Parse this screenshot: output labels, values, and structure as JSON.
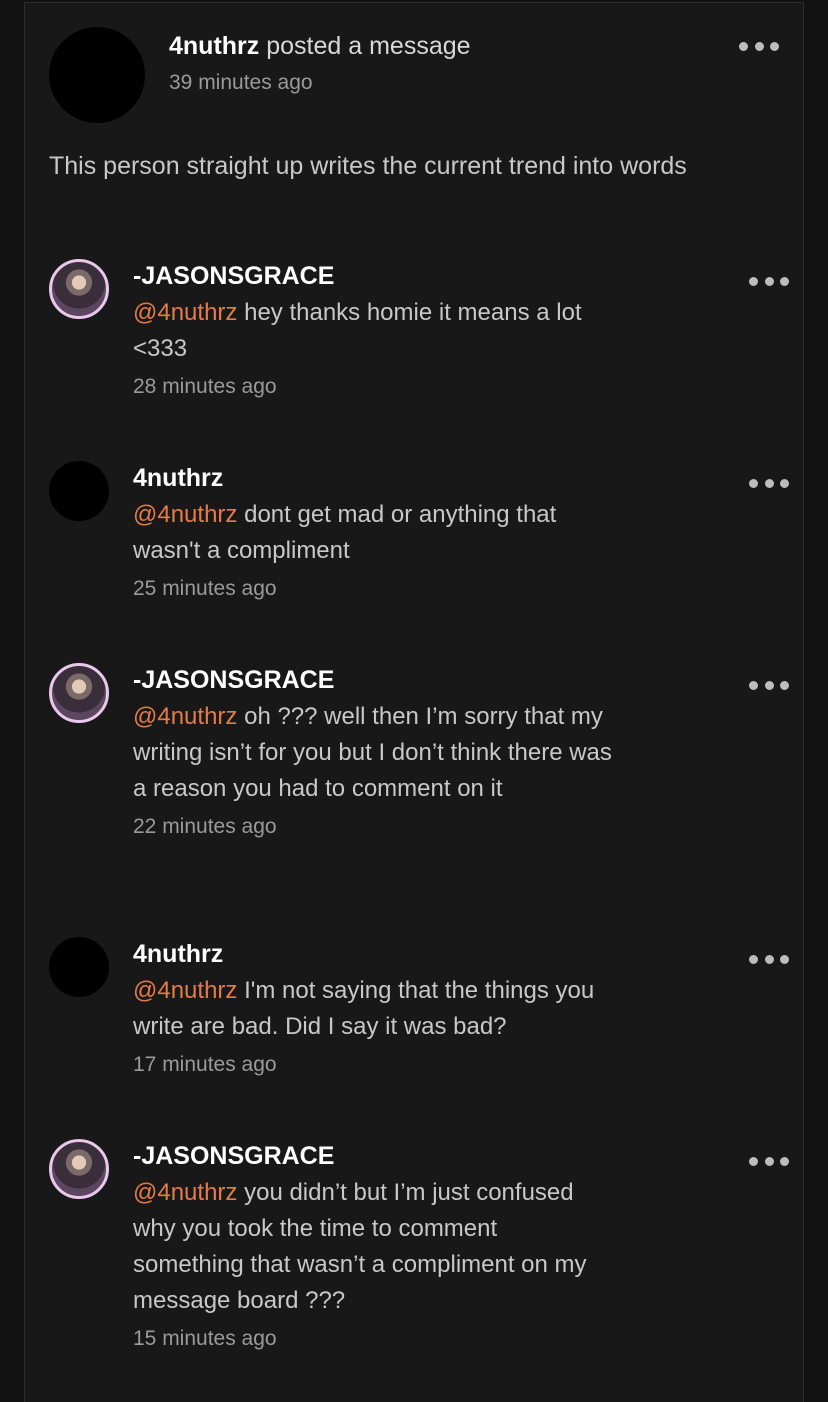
{
  "post": {
    "author": "4nuthrz",
    "action": "posted a message",
    "time": "39 minutes ago",
    "body": "This person straight up writes the current trend into words"
  },
  "replies": [
    {
      "name": "-JASONSGRACE",
      "mention": "@4nuthrz",
      "text": "hey thanks homie it means a lot <333",
      "time": "28 minutes ago",
      "avatar": "photo"
    },
    {
      "name": "4nuthrz",
      "mention": "@4nuthrz",
      "text": "dont get mad or anything that wasn't a compliment",
      "time": "25 minutes ago",
      "avatar": "black"
    },
    {
      "name": "-JASONSGRACE",
      "mention": "@4nuthrz",
      "text": "oh ??? well then I’m sorry that my writing isn’t for you but I don’t think there was a reason you had to comment on it",
      "time": "22 minutes ago",
      "avatar": "photo"
    },
    {
      "name": "4nuthrz",
      "mention": "@4nuthrz",
      "text": "I'm not saying that the things you write are bad. Did I say it was bad?",
      "time": "17 minutes ago",
      "avatar": "black"
    },
    {
      "name": "-JASONSGRACE",
      "mention": "@4nuthrz",
      "text": "you didn’t but I’m just confused why you took the time to comment something that wasn’t a compliment on my message board ???",
      "time": "15 minutes ago",
      "avatar": "photo"
    }
  ],
  "icons": {
    "more": "more-horizontal-icon"
  },
  "colors": {
    "mention": "#e57b47",
    "background": "#121212"
  }
}
